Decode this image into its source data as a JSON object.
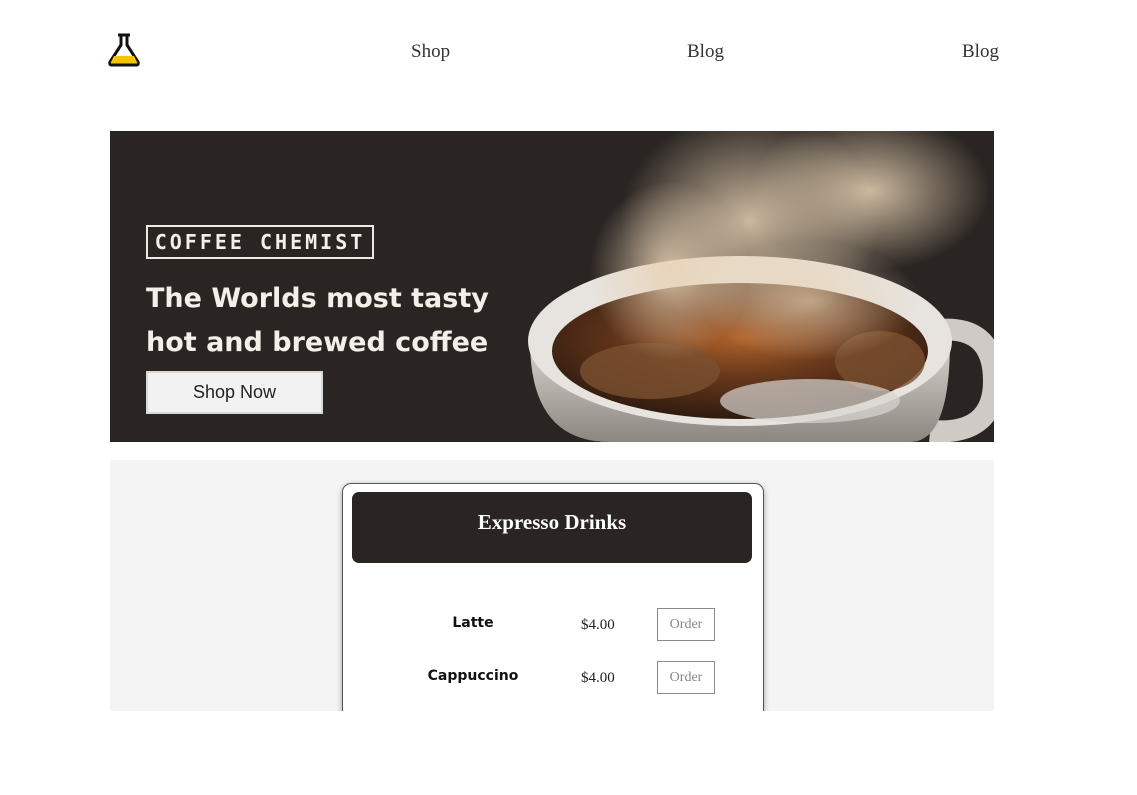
{
  "header": {
    "logo_icon": "flask-icon",
    "nav": [
      "Shop",
      "Blog",
      "Blog"
    ]
  },
  "hero": {
    "brand": "COFFEE CHEMIST",
    "headline_lines": [
      "The Worlds most tasty",
      "hot and brewed coffee"
    ],
    "cta_label": "Shop Now"
  },
  "menu": {
    "title": "Expresso Drinks",
    "items": [
      {
        "name": "Latte",
        "price": "$4.00",
        "order_label": "Order"
      },
      {
        "name": "Cappuccino",
        "price": "$4.00",
        "order_label": "Order"
      }
    ]
  },
  "colors": {
    "dark": "#2a2522",
    "logo_yellow": "#f5c400",
    "section_bg": "#f4f4f4"
  }
}
